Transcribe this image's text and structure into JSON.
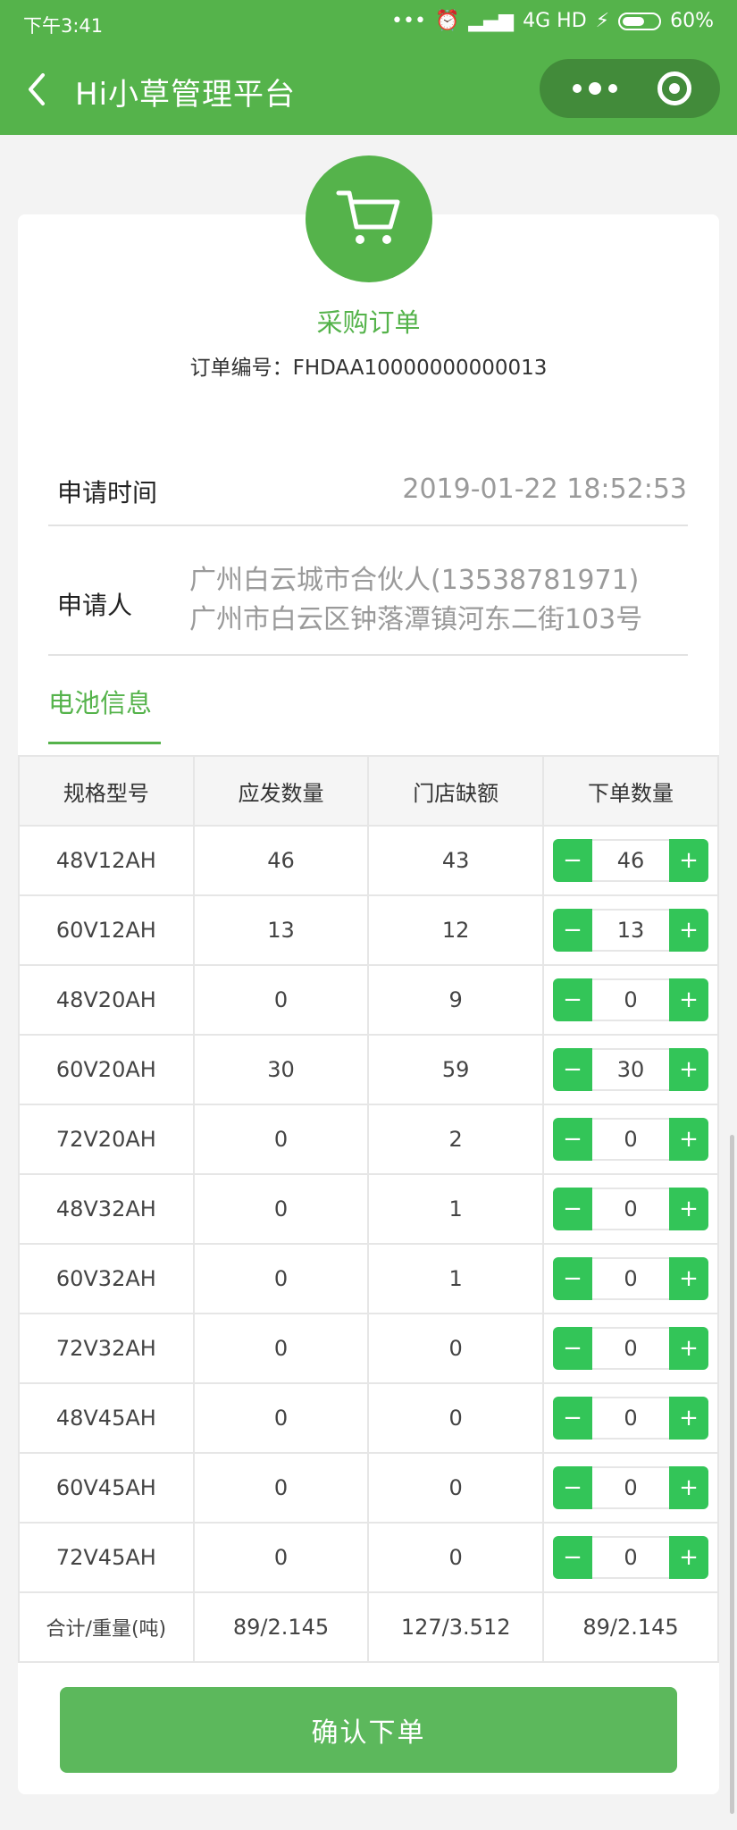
{
  "status_bar": {
    "time": "下午3:41",
    "network": "4G HD",
    "battery": "60%"
  },
  "nav": {
    "title": "Hi小草管理平台"
  },
  "order": {
    "title": "采购订单",
    "number_label": "订单编号：",
    "number": "FHDAA10000000000013"
  },
  "apply_time": {
    "label": "申请时间",
    "value": "2019-01-22 18:52:53"
  },
  "applicant": {
    "label": "申请人",
    "line1": "广州白云城市合伙人(13538781971)",
    "line2": "广州市白云区钟落潭镇河东二街103号"
  },
  "section": {
    "title": "电池信息"
  },
  "table": {
    "headers": [
      "规格型号",
      "应发数量",
      "门店缺额",
      "下单数量"
    ],
    "rows": [
      {
        "model": "48V12AH",
        "ship": "46",
        "short": "43",
        "order": "46"
      },
      {
        "model": "60V12AH",
        "ship": "13",
        "short": "12",
        "order": "13"
      },
      {
        "model": "48V20AH",
        "ship": "0",
        "short": "9",
        "order": "0"
      },
      {
        "model": "60V20AH",
        "ship": "30",
        "short": "59",
        "order": "30"
      },
      {
        "model": "72V20AH",
        "ship": "0",
        "short": "2",
        "order": "0"
      },
      {
        "model": "48V32AH",
        "ship": "0",
        "short": "1",
        "order": "0"
      },
      {
        "model": "60V32AH",
        "ship": "0",
        "short": "1",
        "order": "0"
      },
      {
        "model": "72V32AH",
        "ship": "0",
        "short": "0",
        "order": "0"
      },
      {
        "model": "48V45AH",
        "ship": "0",
        "short": "0",
        "order": "0"
      },
      {
        "model": "60V45AH",
        "ship": "0",
        "short": "0",
        "order": "0"
      },
      {
        "model": "72V45AH",
        "ship": "0",
        "short": "0",
        "order": "0"
      }
    ],
    "stepper_minus": "−",
    "stepper_plus": "+",
    "total": {
      "label": "合计/重量(吨)",
      "ship": "89/2.145",
      "short": "127/3.512",
      "order": "89/2.145"
    }
  },
  "confirm_button": "确认下单",
  "colors": {
    "brand": "#55b34b",
    "stepper": "#33c558"
  }
}
